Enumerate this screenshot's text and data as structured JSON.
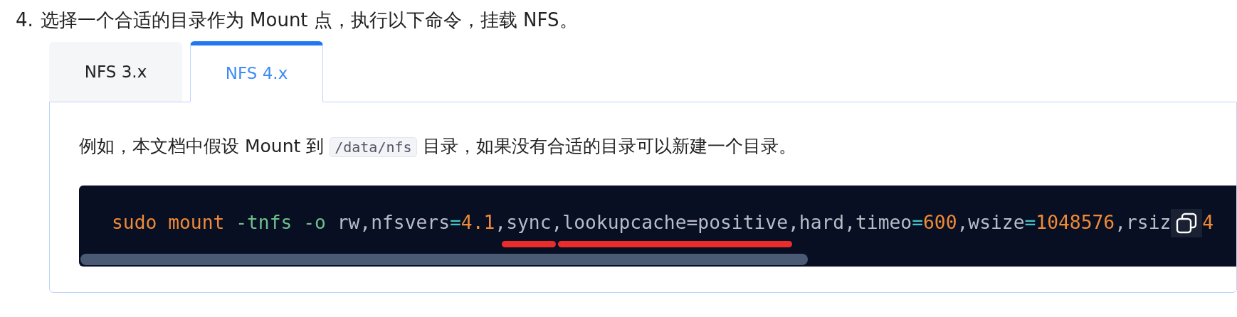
{
  "step": {
    "number": "4.",
    "text": "选择一个合适的目录作为 Mount 点，执行以下命令，挂载 NFS。"
  },
  "tabs": [
    {
      "label": "NFS 3.x",
      "selected": false
    },
    {
      "label": "NFS 4.x",
      "selected": true
    }
  ],
  "panel": {
    "paragraph": [
      {
        "kind": "text",
        "text": "例如，本文档中假设 Mount 到 "
      },
      {
        "kind": "code",
        "text": "/data/nfs"
      },
      {
        "kind": "text",
        "text": " 目录，如果没有合适的目录可以新建一个目录。"
      }
    ],
    "code_block": {
      "tokens": [
        {
          "kind": "keyword",
          "text": "sudo mount",
          "underlined": false
        },
        {
          "kind": "flag",
          "text": " -tnfs -o",
          "underlined": false
        },
        {
          "kind": "plain",
          "text": " rw,nfsvers",
          "underlined": false
        },
        {
          "kind": "operator",
          "text": "=",
          "underlined": false
        },
        {
          "kind": "number",
          "text": "4.1",
          "underlined": false
        },
        {
          "kind": "plain",
          "text": ",",
          "underlined": false
        },
        {
          "kind": "plain",
          "text": "sync",
          "underlined": true
        },
        {
          "kind": "plain",
          "text": ",",
          "underlined": false
        },
        {
          "kind": "plain",
          "text": "lookupcache=positive",
          "underlined": true
        },
        {
          "kind": "plain",
          "text": ",hard,timeo",
          "underlined": false
        },
        {
          "kind": "operator",
          "text": "=",
          "underlined": false
        },
        {
          "kind": "number",
          "text": "600",
          "underlined": false
        },
        {
          "kind": "plain",
          "text": ",wsize",
          "underlined": false
        },
        {
          "kind": "operator",
          "text": "=",
          "underlined": false
        },
        {
          "kind": "number",
          "text": "1048576",
          "underlined": false
        },
        {
          "kind": "plain",
          "text": ",rsiz",
          "underlined": false
        }
      ],
      "after_button": {
        "kind": "number",
        "text": "4"
      }
    }
  }
}
